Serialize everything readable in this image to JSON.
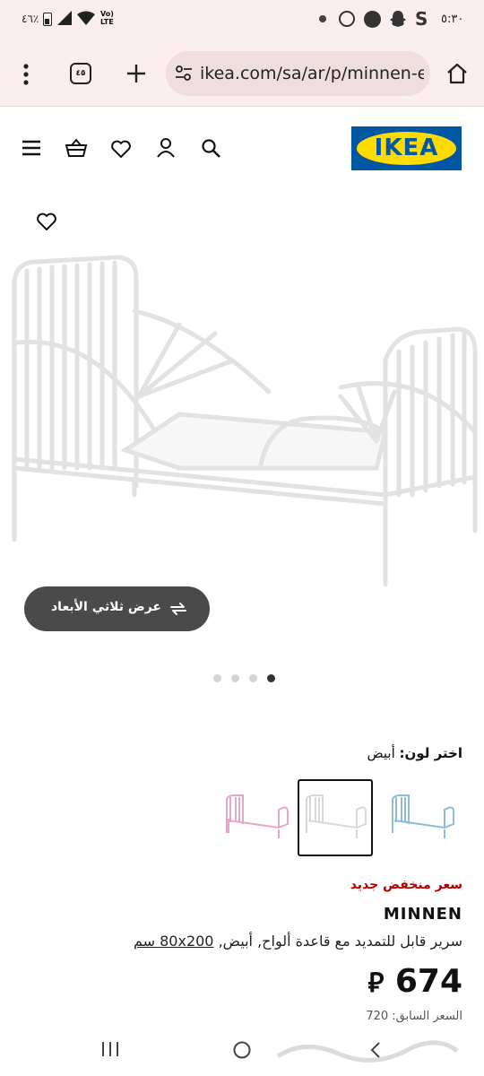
{
  "status_bar": {
    "time": "٥:٣٠",
    "battery": "٤٦٪",
    "network": "LTE",
    "carrier": "Vo)"
  },
  "browser": {
    "url": "ikea.com/sa/ar/p/minnen-ex",
    "tab_count": "٤٥"
  },
  "header": {
    "logo_text": "IKEA"
  },
  "gallery": {
    "view_3d_label": "عرض ثلاثي الأبعاد",
    "dots_total": 4,
    "active_dot_index": 0
  },
  "color_chooser": {
    "label": "اختر لون:",
    "selected_value": "أبيض",
    "swatches": [
      "pink",
      "white",
      "blue"
    ],
    "selected_index": 1
  },
  "product": {
    "badge": "سعر منخفض جديد",
    "name": "MINNEN",
    "description": "سرير قابل للتمديد مع قاعدة ألواح, أبيض,",
    "size": "80x200 سم",
    "price": "674",
    "currency_symbol": "⃁",
    "old_price_text": "السعر السابق: 720"
  },
  "colors": {
    "ikea_blue": "#0058a3",
    "ikea_yellow": "#ffdb00",
    "badge_red": "#b30000",
    "browser_bg": "#fbeeee"
  }
}
